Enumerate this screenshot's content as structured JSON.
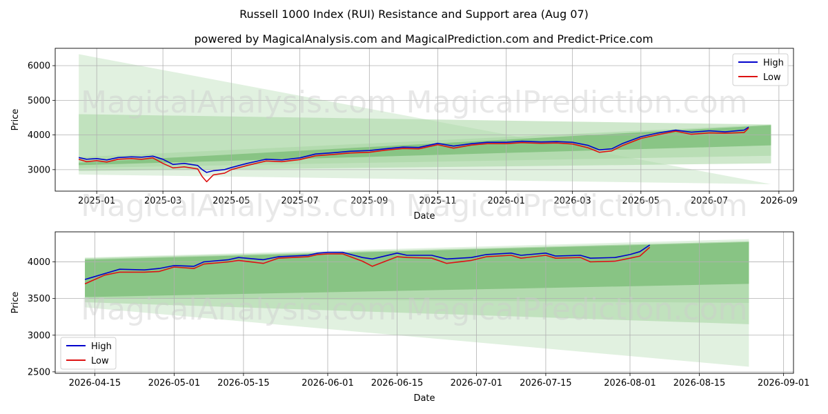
{
  "figure": {
    "title": "Russell 1000 Index (RUI) Resistance and Support area (Aug 07)",
    "subtitle": "powered by MagicalAnalysis.com and MagicalPrediction.com and Predict-Price.com",
    "watermark_left": "MagicalAnalysis.com",
    "watermark_right": "MagicalPrediction.com"
  },
  "colors": {
    "high": "#0000cc",
    "low": "#dd1111",
    "band_light": "#c9e5c6",
    "band_mid": "#a7d5a3",
    "band_dark": "#79bc76",
    "grid": "#b0b0b0"
  },
  "chart_data": [
    {
      "type": "line",
      "xlabel": "Date",
      "ylabel": "Price",
      "xlim": [
        "2024-11-25",
        "2026-09-14"
      ],
      "ylim": [
        2380,
        6500
      ],
      "grid": true,
      "legend": "top-right",
      "x_ticks": [
        "2025-01-01",
        "2025-03-01",
        "2025-05-01",
        "2025-07-01",
        "2025-09-01",
        "2025-11-01",
        "2026-01-01",
        "2026-03-01",
        "2026-05-01",
        "2026-07-01",
        "2026-09-01"
      ],
      "x_tick_labels": [
        "2025-01",
        "2025-03",
        "2025-05",
        "2025-07",
        "2025-09",
        "2025-11",
        "2026-01",
        "2026-03",
        "2026-05",
        "2026-07",
        "2026-09"
      ],
      "y_ticks": [
        3000,
        4000,
        5000,
        6000
      ],
      "y_tick_labels": [
        "3000",
        "4000",
        "5000",
        "6000"
      ],
      "bands": [
        {
          "x": [
            "2024-12-16",
            "2026-08-25"
          ],
          "upper": [
            6330,
            2580
          ],
          "lower": [
            2860,
            2580
          ],
          "shade": "light"
        },
        {
          "x": [
            "2024-12-16",
            "2026-08-25"
          ],
          "upper": [
            4600,
            4300
          ],
          "lower": [
            2960,
            3180
          ],
          "shade": "mid"
        },
        {
          "x": [
            "2024-12-16",
            "2026-08-25"
          ],
          "upper": [
            3360,
            4300
          ],
          "lower": [
            3050,
            3400
          ],
          "shade": "mid"
        },
        {
          "x": [
            "2024-12-16",
            "2026-08-25"
          ],
          "upper": [
            3200,
            4280
          ],
          "lower": [
            3130,
            3700
          ],
          "shade": "dark"
        }
      ],
      "series": [
        {
          "name": "High",
          "x": [
            "2024-12-16",
            "2024-12-23",
            "2025-01-01",
            "2025-01-10",
            "2025-01-20",
            "2025-02-01",
            "2025-02-10",
            "2025-02-20",
            "2025-03-01",
            "2025-03-10",
            "2025-03-20",
            "2025-04-01",
            "2025-04-05",
            "2025-04-09",
            "2025-04-15",
            "2025-04-25",
            "2025-05-01",
            "2025-05-15",
            "2025-06-01",
            "2025-06-15",
            "2025-07-01",
            "2025-07-15",
            "2025-08-01",
            "2025-08-15",
            "2025-09-01",
            "2025-09-15",
            "2025-10-01",
            "2025-10-15",
            "2025-11-01",
            "2025-11-15",
            "2025-12-01",
            "2025-12-15",
            "2026-01-01",
            "2026-01-15",
            "2026-02-01",
            "2026-02-15",
            "2026-03-01",
            "2026-03-15",
            "2026-03-25",
            "2026-04-05",
            "2026-04-15",
            "2026-05-01",
            "2026-05-15",
            "2026-06-01",
            "2026-06-15",
            "2026-07-01",
            "2026-07-15",
            "2026-08-01",
            "2026-08-05"
          ],
          "y": [
            3350,
            3300,
            3320,
            3280,
            3350,
            3370,
            3360,
            3390,
            3300,
            3150,
            3180,
            3120,
            3000,
            2920,
            2970,
            3000,
            3060,
            3180,
            3300,
            3280,
            3340,
            3450,
            3490,
            3530,
            3550,
            3600,
            3650,
            3640,
            3760,
            3680,
            3750,
            3790,
            3790,
            3820,
            3800,
            3810,
            3790,
            3700,
            3570,
            3600,
            3760,
            3950,
            4050,
            4140,
            4080,
            4120,
            4090,
            4140,
            4230
          ]
        },
        {
          "name": "Low",
          "x": [
            "2024-12-16",
            "2024-12-23",
            "2025-01-01",
            "2025-01-10",
            "2025-01-20",
            "2025-02-01",
            "2025-02-10",
            "2025-02-20",
            "2025-03-01",
            "2025-03-10",
            "2025-03-20",
            "2025-04-01",
            "2025-04-05",
            "2025-04-09",
            "2025-04-15",
            "2025-04-25",
            "2025-05-01",
            "2025-05-15",
            "2025-06-01",
            "2025-06-15",
            "2025-07-01",
            "2025-07-15",
            "2025-08-01",
            "2025-08-15",
            "2025-09-01",
            "2025-09-15",
            "2025-10-01",
            "2025-10-15",
            "2025-11-01",
            "2025-11-15",
            "2025-12-01",
            "2025-12-15",
            "2026-01-01",
            "2026-01-15",
            "2026-02-01",
            "2026-02-15",
            "2026-03-01",
            "2026-03-15",
            "2026-03-25",
            "2026-04-05",
            "2026-04-15",
            "2026-05-01",
            "2026-05-15",
            "2026-06-01",
            "2026-06-15",
            "2026-07-01",
            "2026-07-15",
            "2026-08-01",
            "2026-08-05"
          ],
          "y": [
            3300,
            3230,
            3260,
            3220,
            3300,
            3320,
            3300,
            3340,
            3180,
            3050,
            3080,
            3020,
            2800,
            2650,
            2850,
            2900,
            3000,
            3120,
            3250,
            3230,
            3290,
            3400,
            3440,
            3480,
            3500,
            3560,
            3610,
            3600,
            3720,
            3620,
            3710,
            3750,
            3750,
            3780,
            3760,
            3770,
            3740,
            3630,
            3500,
            3540,
            3700,
            3900,
            4000,
            4110,
            4020,
            4060,
            4050,
            4070,
            4200
          ]
        }
      ]
    },
    {
      "type": "line",
      "xlabel": "Date",
      "ylabel": "Price",
      "xlim": [
        "2026-04-07",
        "2026-09-03"
      ],
      "ylim": [
        2480,
        4410
      ],
      "grid": true,
      "legend": "bottom-left",
      "x_ticks": [
        "2026-04-15",
        "2026-05-01",
        "2026-05-15",
        "2026-06-01",
        "2026-06-15",
        "2026-07-01",
        "2026-07-15",
        "2026-08-01",
        "2026-08-15",
        "2026-09-01"
      ],
      "x_tick_labels": [
        "2026-04-15",
        "2026-05-01",
        "2026-05-15",
        "2026-06-01",
        "2026-06-15",
        "2026-07-01",
        "2026-07-15",
        "2026-08-01",
        "2026-08-15",
        "2026-09-01"
      ],
      "y_ticks": [
        2500,
        3000,
        3500,
        4000
      ],
      "y_tick_labels": [
        "2500",
        "3000",
        "3500",
        "4000"
      ],
      "bands": [
        {
          "x": [
            "2026-04-13",
            "2026-08-25"
          ],
          "upper": [
            4060,
            4310
          ],
          "lower": [
            3380,
            2570
          ],
          "shade": "light"
        },
        {
          "x": [
            "2026-04-13",
            "2026-08-25"
          ],
          "upper": [
            4050,
            4280
          ],
          "lower": [
            3450,
            3150
          ],
          "shade": "mid"
        },
        {
          "x": [
            "2026-04-13",
            "2026-08-25"
          ],
          "upper": [
            4040,
            4280
          ],
          "lower": [
            3510,
            3440
          ],
          "shade": "mid"
        },
        {
          "x": [
            "2026-04-13",
            "2026-08-25"
          ],
          "upper": [
            4030,
            4270
          ],
          "lower": [
            3520,
            3700
          ],
          "shade": "dark"
        }
      ],
      "series": [
        {
          "name": "High",
          "x": [
            "2026-04-13",
            "2026-04-15",
            "2026-04-17",
            "2026-04-20",
            "2026-04-25",
            "2026-04-28",
            "2026-05-01",
            "2026-05-05",
            "2026-05-07",
            "2026-05-12",
            "2026-05-14",
            "2026-05-19",
            "2026-05-22",
            "2026-05-28",
            "2026-05-30",
            "2026-06-01",
            "2026-06-04",
            "2026-06-08",
            "2026-06-10",
            "2026-06-15",
            "2026-06-17",
            "2026-06-22",
            "2026-06-25",
            "2026-06-30",
            "2026-07-03",
            "2026-07-08",
            "2026-07-10",
            "2026-07-15",
            "2026-07-17",
            "2026-07-22",
            "2026-07-24",
            "2026-07-29",
            "2026-08-01",
            "2026-08-03",
            "2026-08-05"
          ],
          "y": [
            3760,
            3800,
            3840,
            3900,
            3890,
            3910,
            3950,
            3940,
            4000,
            4030,
            4060,
            4030,
            4070,
            4090,
            4120,
            4130,
            4130,
            4060,
            4040,
            4120,
            4090,
            4090,
            4040,
            4060,
            4100,
            4120,
            4090,
            4120,
            4080,
            4090,
            4050,
            4060,
            4100,
            4140,
            4230
          ]
        },
        {
          "name": "Low",
          "x": [
            "2026-04-13",
            "2026-04-15",
            "2026-04-17",
            "2026-04-20",
            "2026-04-25",
            "2026-04-28",
            "2026-05-01",
            "2026-05-05",
            "2026-05-07",
            "2026-05-12",
            "2026-05-14",
            "2026-05-19",
            "2026-05-22",
            "2026-05-28",
            "2026-05-30",
            "2026-06-01",
            "2026-06-04",
            "2026-06-08",
            "2026-06-10",
            "2026-06-15",
            "2026-06-17",
            "2026-06-22",
            "2026-06-25",
            "2026-06-30",
            "2026-07-03",
            "2026-07-08",
            "2026-07-10",
            "2026-07-15",
            "2026-07-17",
            "2026-07-22",
            "2026-07-24",
            "2026-07-29",
            "2026-08-01",
            "2026-08-03",
            "2026-08-05"
          ],
          "y": [
            3700,
            3760,
            3820,
            3860,
            3860,
            3870,
            3930,
            3910,
            3970,
            4000,
            4020,
            3980,
            4050,
            4070,
            4100,
            4110,
            4110,
            4010,
            3940,
            4070,
            4060,
            4050,
            3980,
            4020,
            4070,
            4090,
            4050,
            4090,
            4050,
            4060,
            4000,
            4010,
            4050,
            4080,
            4200
          ]
        }
      ]
    }
  ]
}
